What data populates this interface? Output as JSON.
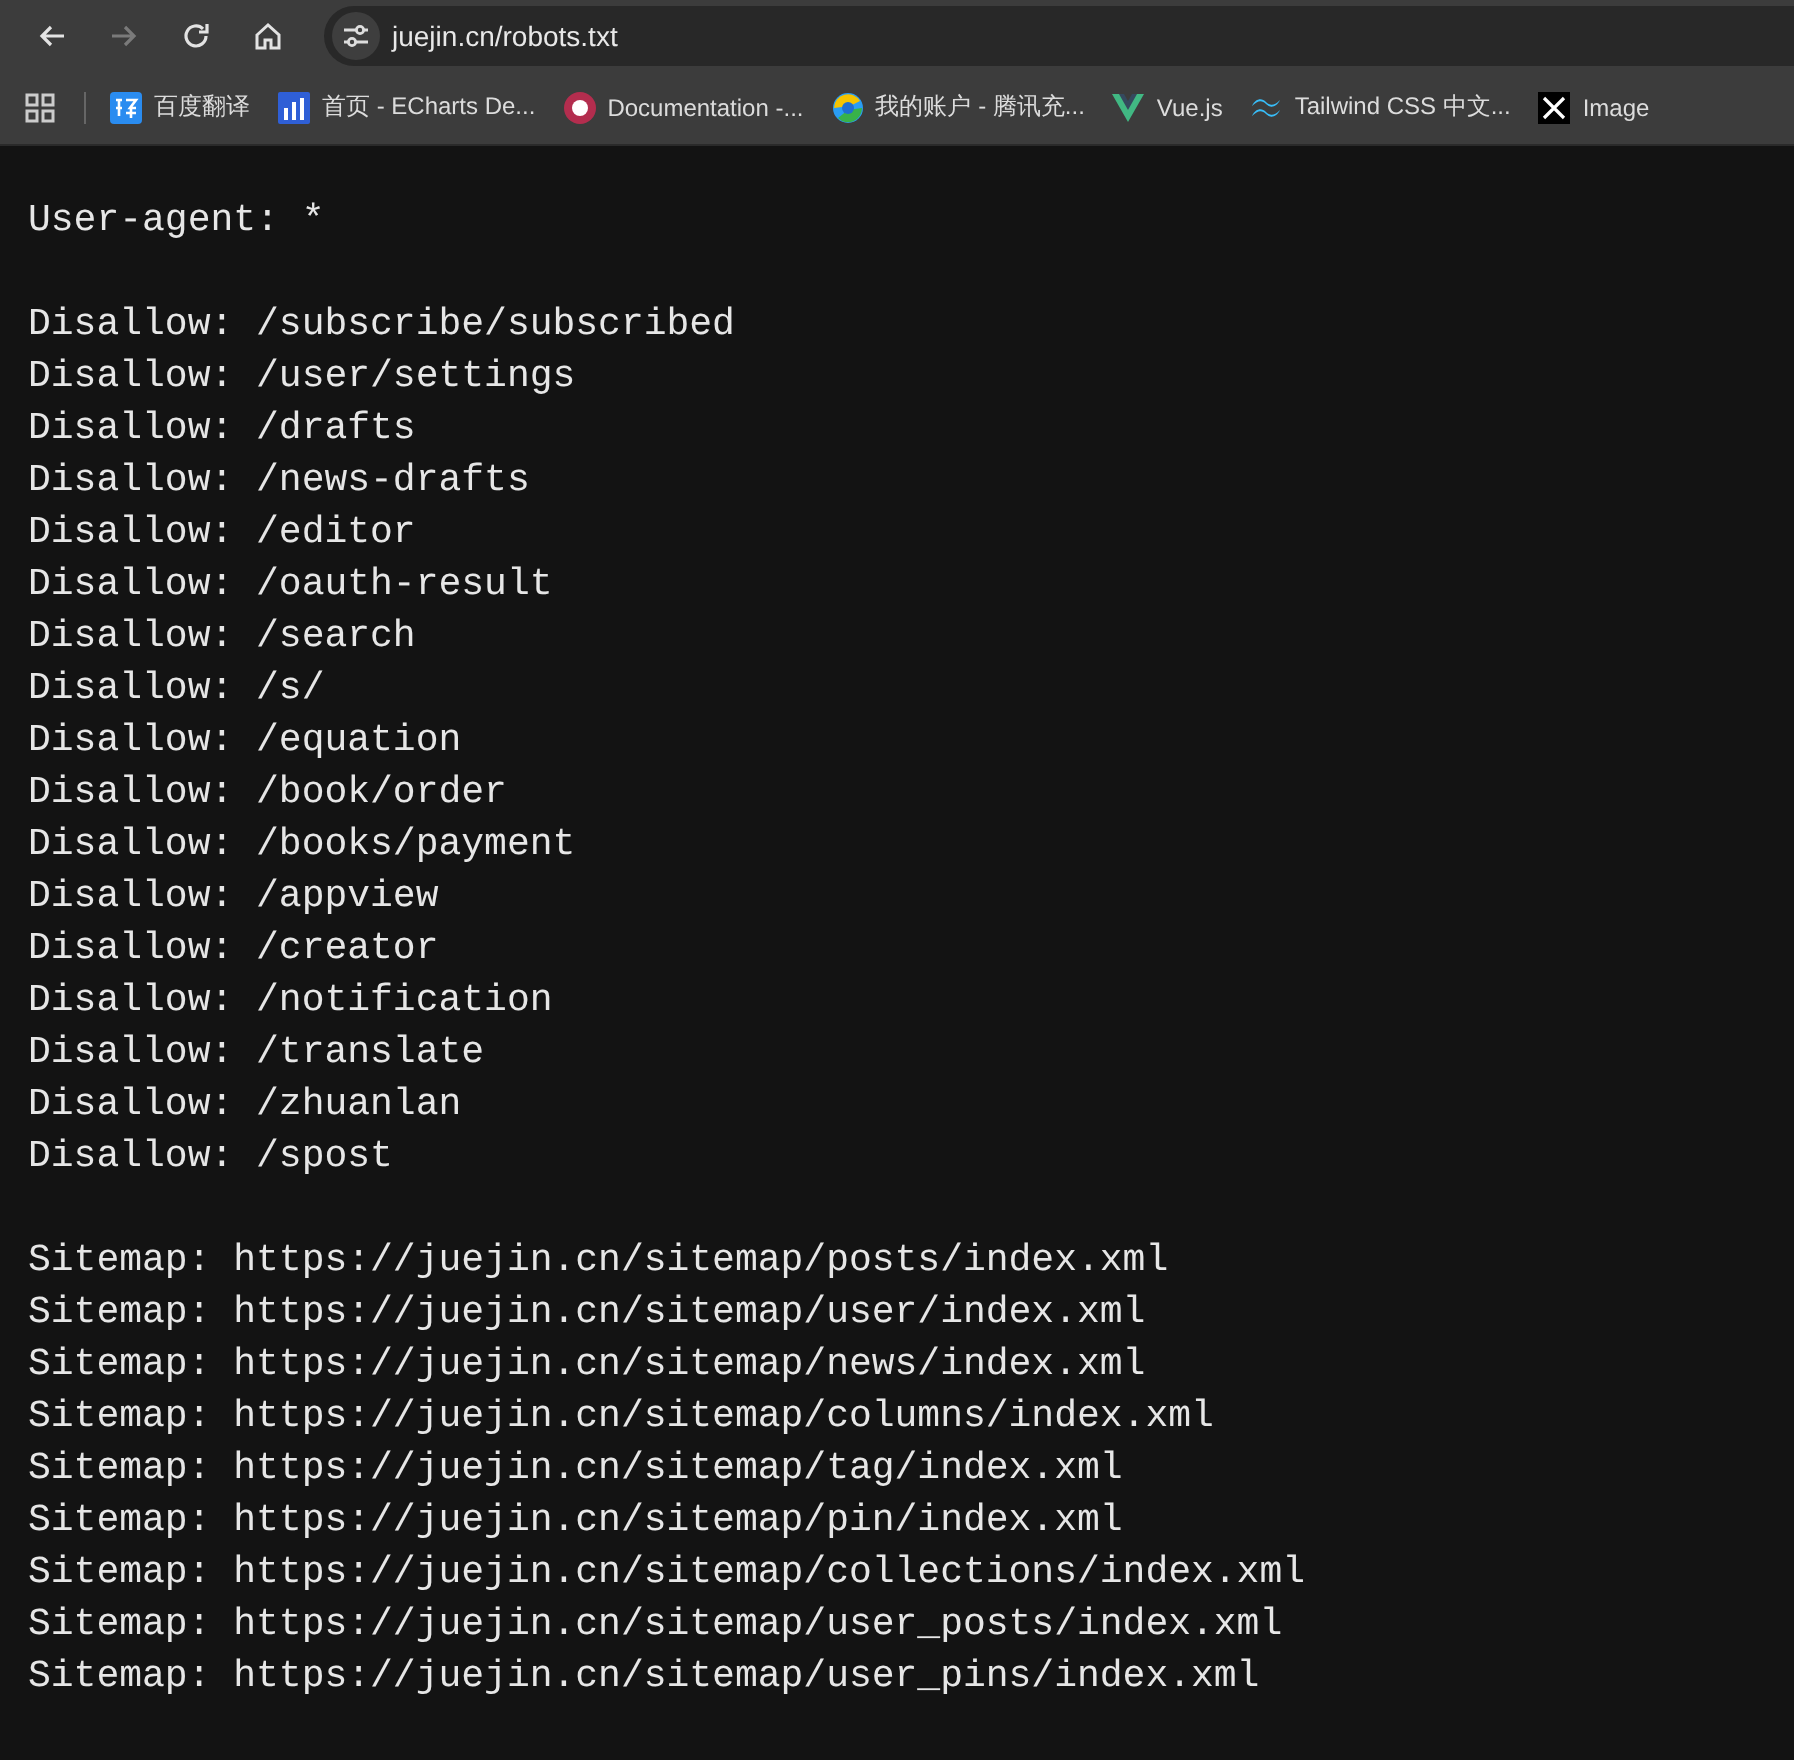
{
  "toolbar": {
    "nav": [
      {
        "kind": "back",
        "disabled": false
      },
      {
        "kind": "forward",
        "disabled": true
      },
      {
        "kind": "reload",
        "disabled": false
      },
      {
        "kind": "home",
        "disabled": false
      }
    ],
    "address": "juejin.cn/robots.txt"
  },
  "bookmarks": [
    {
      "kind": "badge",
      "label": "百度翻译"
    },
    {
      "kind": "bars",
      "label": "首页 - ECharts De..."
    },
    {
      "kind": "ring",
      "label": "Documentation -..."
    },
    {
      "kind": "swirl",
      "label": "我的账户 - 腾讯充..."
    },
    {
      "kind": "vee",
      "label": "Vue.js"
    },
    {
      "kind": "wave",
      "label": "Tailwind CSS 中文..."
    },
    {
      "kind": "cross",
      "label": "Image"
    }
  ],
  "document": {
    "groups": [
      {
        "lines": [
          "User-agent: *"
        ]
      },
      {
        "lines": [
          "Disallow: /subscribe/subscribed",
          "Disallow: /user/settings",
          "Disallow: /drafts",
          "Disallow: /news-drafts",
          "Disallow: /editor",
          "Disallow: /oauth-result",
          "Disallow: /search",
          "Disallow: /s/",
          "Disallow: /equation",
          "Disallow: /book/order",
          "Disallow: /books/payment",
          "Disallow: /appview",
          "Disallow: /creator",
          "Disallow: /notification",
          "Disallow: /translate",
          "Disallow: /zhuanlan",
          "Disallow: /spost"
        ]
      },
      {
        "lines": [
          "Sitemap: https://juejin.cn/sitemap/posts/index.xml",
          "Sitemap: https://juejin.cn/sitemap/user/index.xml",
          "Sitemap: https://juejin.cn/sitemap/news/index.xml",
          "Sitemap: https://juejin.cn/sitemap/columns/index.xml",
          "Sitemap: https://juejin.cn/sitemap/tag/index.xml",
          "Sitemap: https://juejin.cn/sitemap/pin/index.xml",
          "Sitemap: https://juejin.cn/sitemap/collections/index.xml",
          "Sitemap: https://juejin.cn/sitemap/user_posts/index.xml",
          "Sitemap: https://juejin.cn/sitemap/user_pins/index.xml"
        ]
      }
    ]
  }
}
